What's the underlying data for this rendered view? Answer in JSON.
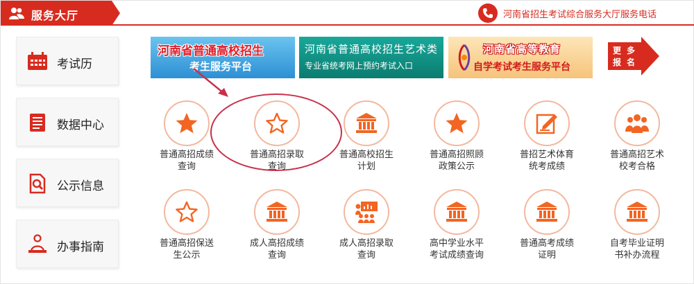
{
  "header": {
    "title": "服务大厅",
    "phone_text": "河南省招生考试综合服务大厅服务电话"
  },
  "sidebar": {
    "items": [
      {
        "label": "考试历"
      },
      {
        "label": "数据中心"
      },
      {
        "label": "公示信息"
      },
      {
        "label": "办事指南"
      }
    ]
  },
  "banners": {
    "b1": {
      "line1": "河南省普通高校招生",
      "line2": "考生服务平台"
    },
    "b2": {
      "line1": "河南省普通高校招生艺术类",
      "line2": "专业省统考网上预约考试入口"
    },
    "b3": {
      "line1": "河南省高等教育",
      "line2": "自学考试考生服务平台"
    },
    "more": {
      "line1": "更多",
      "line2": "报名"
    }
  },
  "services": [
    {
      "line1": "普通高招成绩",
      "line2": "查询",
      "icon": "star-filled-icon"
    },
    {
      "line1": "普通高招录取",
      "line2": "查询",
      "icon": "star-outline-icon"
    },
    {
      "line1": "普通高校招生",
      "line2": "计划",
      "icon": "building-icon"
    },
    {
      "line1": "普通高招照顾",
      "line2": "政策公示",
      "icon": "star-filled-icon"
    },
    {
      "line1": "普招艺术体育",
      "line2": "统考成绩",
      "icon": "edit-icon"
    },
    {
      "line1": "普通高招艺术",
      "line2": "校考合格",
      "icon": "group-icon"
    },
    {
      "line1": "普通高招保送",
      "line2": "生公示",
      "icon": "star-outline-icon"
    },
    {
      "line1": "成人高招成绩",
      "line2": "查询",
      "icon": "building-icon"
    },
    {
      "line1": "成人高招录取",
      "line2": "查询",
      "icon": "presentation-icon"
    },
    {
      "line1": "高中学业水平",
      "line2": "考试成绩查询",
      "icon": "building-icon"
    },
    {
      "line1": "普通高考成绩",
      "line2": "证明",
      "icon": "building-icon"
    },
    {
      "line1": "自考毕业证明",
      "line2": "书补办流程",
      "icon": "building-icon"
    }
  ],
  "colors": {
    "accent": "#d82b1f",
    "icon": "#f26522",
    "ring": "#f3b89e"
  }
}
